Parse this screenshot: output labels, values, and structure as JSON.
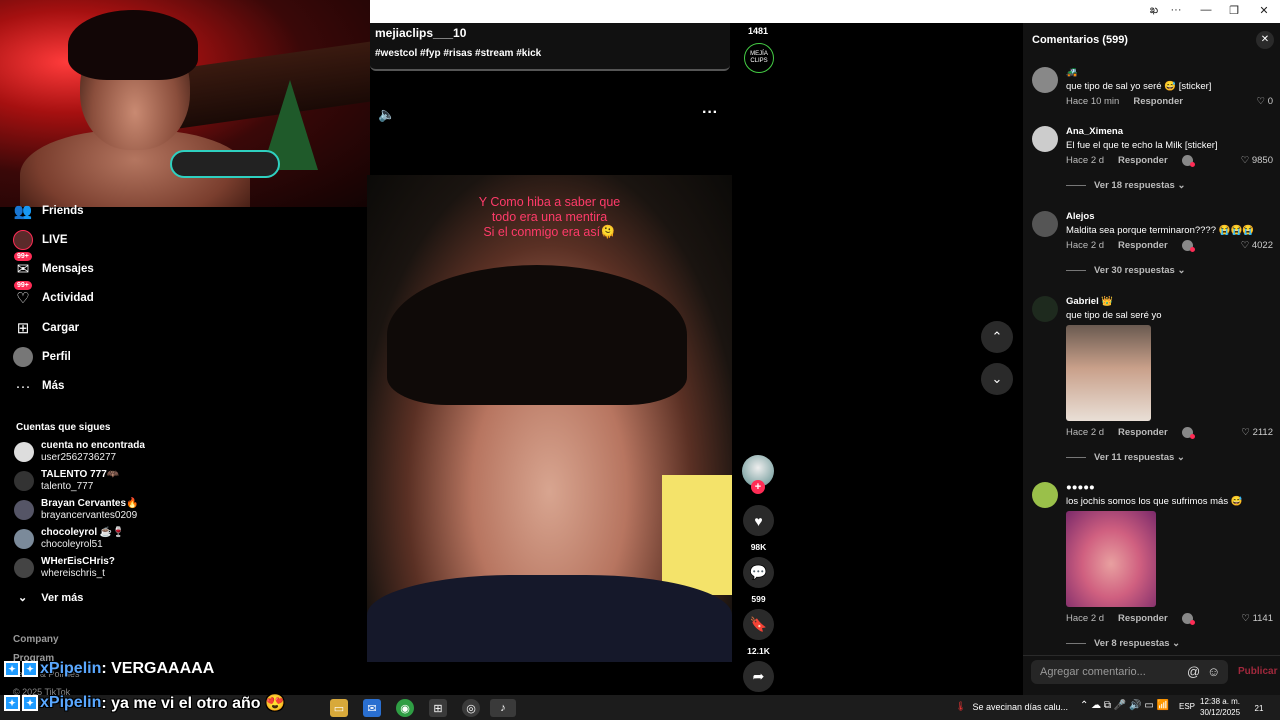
{
  "window": {
    "controls": [
      "ఖ",
      "···",
      "—",
      "❐",
      "✕"
    ]
  },
  "sidebar": {
    "nav": [
      {
        "label": "Friends",
        "icon": "friends-icon",
        "badge": ""
      },
      {
        "label": "LIVE",
        "icon": "live-icon",
        "badge": ""
      },
      {
        "label": "Mensajes",
        "icon": "messages-icon",
        "badge": "99+"
      },
      {
        "label": "Actividad",
        "icon": "activity-icon",
        "badge": "99+"
      },
      {
        "label": "Cargar",
        "icon": "upload-icon",
        "badge": ""
      },
      {
        "label": "Perfil",
        "icon": "profile-icon",
        "badge": ""
      },
      {
        "label": "Más",
        "icon": "more-icon",
        "badge": ""
      }
    ],
    "following_title": "Cuentas que sigues",
    "accounts": [
      {
        "name": "cuenta no encontrada",
        "username": "user2562736277"
      },
      {
        "name": "TALENTO 777🦇",
        "username": "talento_777"
      },
      {
        "name": "Brayan Cervantes🔥",
        "username": "brayancervantes0209"
      },
      {
        "name": "chocoleyrol ☕🍷",
        "username": "chocoleyrol51"
      },
      {
        "name": "WHerEisCHris?",
        "username": "whereischris_t"
      }
    ],
    "see_more": "Ver más",
    "footer": {
      "company": "Company",
      "program": "Program",
      "terms": "Terms & Policies",
      "copyright": "© 2025 TikTok"
    }
  },
  "stream_chat": [
    {
      "user": "xPipelin",
      "message": ": VERGAAAAA"
    },
    {
      "user": "xPipelin",
      "message": ": ya me vi el otro año 😍"
    }
  ],
  "video": {
    "author": "mejiaclips___10",
    "tags": "#westcol #fyp #risas #stream #kick",
    "caption_lines": [
      "Y Como hiba a saber que",
      "todo era una mentira",
      "Si el conmigo era así🫠"
    ],
    "view_count": "1481",
    "author_logo_text": "MEJÍA CLIPS",
    "likes": "98K",
    "comments": "599",
    "saves": "12.1K"
  },
  "comments": {
    "title": "Comentarios (599)",
    "items": [
      {
        "name": "🚜",
        "text": "que tipo de sal yo seré 😅 [sticker]",
        "time": "Hace 10 min",
        "reply": "Responder",
        "likes": "0",
        "replies": ""
      },
      {
        "name": "Ana_Ximena",
        "text": "El fue el que te echo la Milk [sticker]",
        "time": "Hace 2 d",
        "reply": "Responder",
        "likes": "9850",
        "replies": "Ver 18 respuestas"
      },
      {
        "name": "Alejos",
        "text": "Maldita sea porque terminaron???? 😭😭😭",
        "time": "Hace 2 d",
        "reply": "Responder",
        "likes": "4022",
        "replies": "Ver 30 respuestas"
      },
      {
        "name": "Gabriel 👑",
        "text": "que tipo de sal seré yo",
        "time": "Hace 2 d",
        "reply": "Responder",
        "likes": "2112",
        "replies": "Ver 11 respuestas"
      },
      {
        "name": "●●●●●",
        "text": "los jochis somos los que sufrimos más 😅",
        "time": "Hace 2 d",
        "reply": "Responder",
        "likes": "1141",
        "replies": "Ver 8 respuestas"
      }
    ],
    "input_placeholder": "Agregar comentario...",
    "post_label": "Publicar"
  },
  "taskbar": {
    "weather_text": "Se avecinan días calu...",
    "lang": "ESP",
    "time": "12:38 a. m.",
    "date": "30/12/2025",
    "notification_count": "21"
  }
}
